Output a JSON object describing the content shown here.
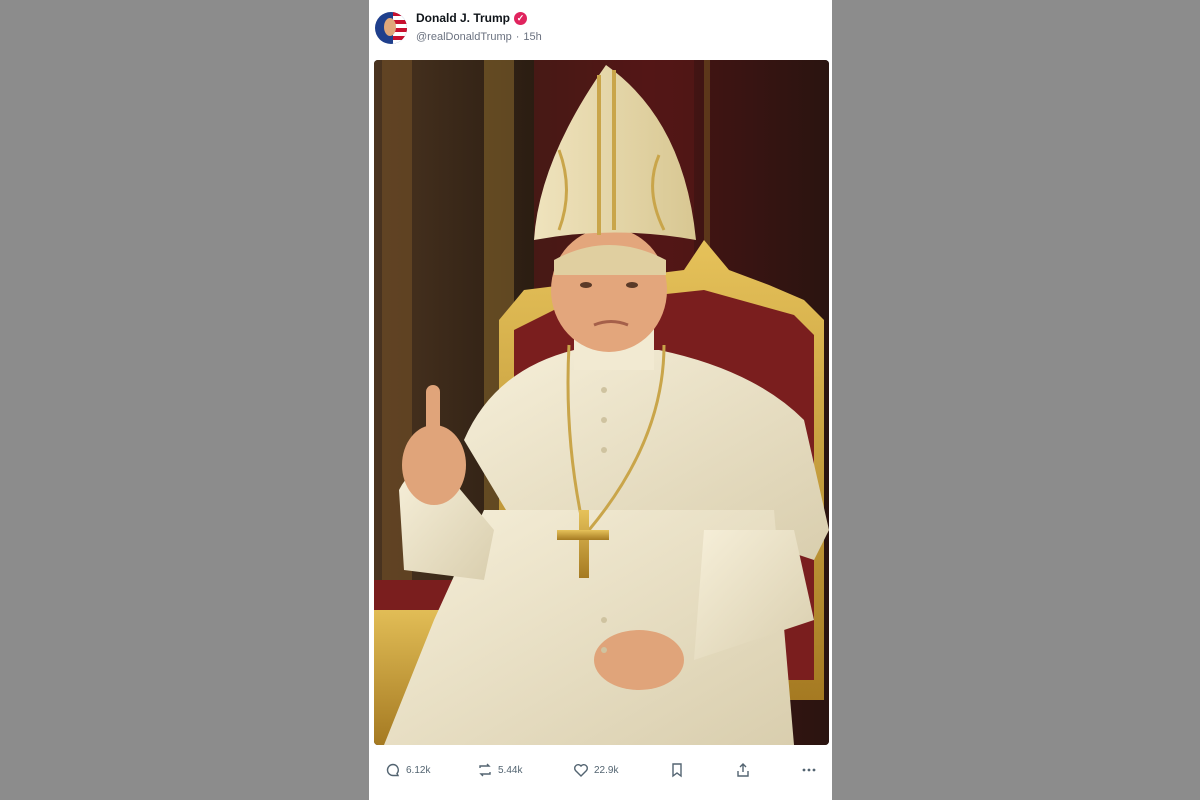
{
  "post": {
    "author": {
      "display_name": "Donald J. Trump",
      "handle": "@realDonaldTrump",
      "verified_icon": "verified-badge-icon"
    },
    "timestamp": "15h",
    "separator": "·",
    "image": {
      "icon": "post-image"
    },
    "actions": {
      "reply_count": "6.12k",
      "repost_count": "5.44k",
      "like_count": "22.9k"
    }
  },
  "colors": {
    "background": "#8c8c8c",
    "card": "#ffffff",
    "verified": "#e0245e",
    "text_primary": "#0f1419",
    "text_secondary": "#536471"
  }
}
